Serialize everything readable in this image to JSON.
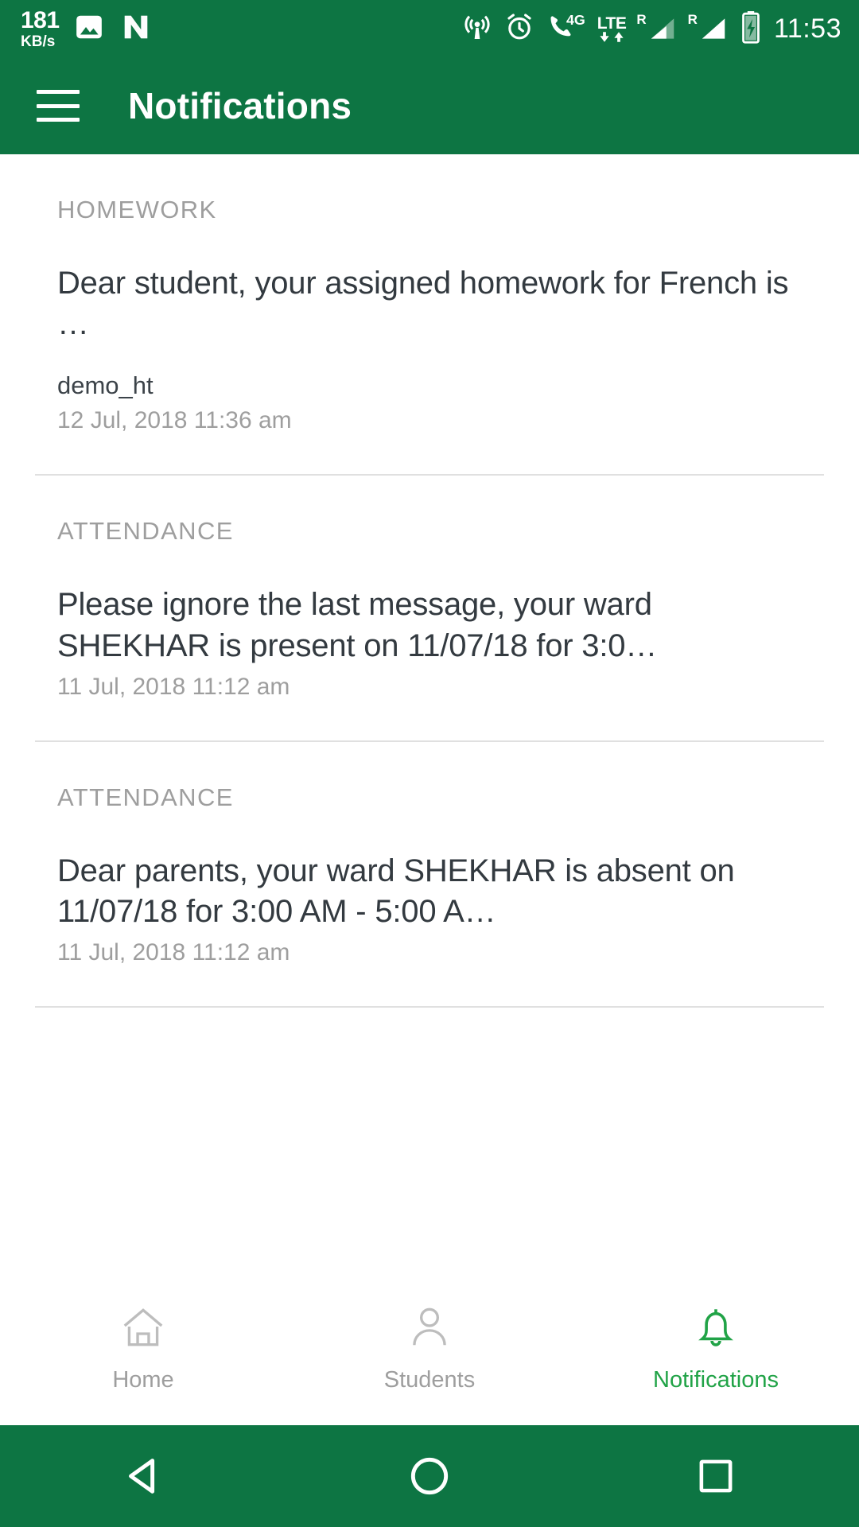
{
  "status_bar": {
    "net_speed_value": "181",
    "net_speed_unit": "KB/s",
    "clock": "11:53",
    "icons": [
      "gallery-icon",
      "nougat-icon",
      "hotspot-icon",
      "alarm-icon",
      "call-4g-icon",
      "lte-data-icon",
      "signal-roaming-1-icon",
      "signal-roaming-2-icon",
      "battery-charging-icon"
    ],
    "lte_label": "LTE",
    "roaming_label": "R",
    "network_label": "4G"
  },
  "app_bar": {
    "title": "Notifications",
    "menu_icon": "hamburger-icon"
  },
  "notifications": [
    {
      "category": "HOMEWORK",
      "body": "Dear student, your assigned homework for French is …",
      "sender": "demo_ht",
      "time": "12 Jul, 2018 11:36 am"
    },
    {
      "category": "ATTENDANCE",
      "body": "Please ignore the last message, your ward SHEKHAR is present on 11/07/18 for 3:0…",
      "sender": "",
      "time": "11 Jul, 2018 11:12 am"
    },
    {
      "category": "ATTENDANCE",
      "body": "Dear parents, your ward SHEKHAR is absent on 11/07/18 for 3:00 AM - 5:00 A…",
      "sender": "",
      "time": "11 Jul, 2018 11:12 am"
    }
  ],
  "bottom_nav": {
    "items": [
      {
        "label": "Home",
        "icon": "home-icon",
        "active": false
      },
      {
        "label": "Students",
        "icon": "person-icon",
        "active": false
      },
      {
        "label": "Notifications",
        "icon": "bell-icon",
        "active": true
      }
    ]
  },
  "system_nav": {
    "back": "back-triangle-icon",
    "home": "home-circle-icon",
    "recents": "recents-square-icon"
  },
  "colors": {
    "brand_green": "#0d7543",
    "accent_green": "#21a347",
    "muted_text": "#9e9e9e",
    "body_text": "#333a40",
    "divider": "#e0e0e0"
  }
}
